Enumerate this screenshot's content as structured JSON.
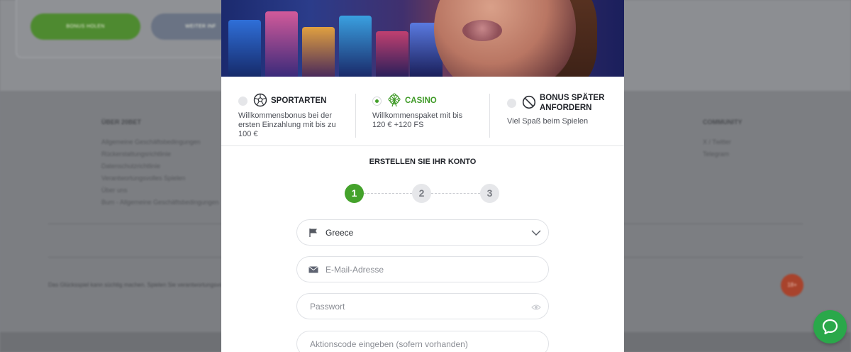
{
  "background": {
    "buttons": {
      "bonus": "BONUS HOLEN",
      "other": "WEITER INF"
    },
    "footer": {
      "col1_title": "ÜBER 20BET",
      "col1_links": [
        "Allgemeine Geschäftsbedingungen",
        "Rückerstattungsrichtlinie",
        "Datenschutzrichtlinie",
        "Verantwortungsvolles Spielen",
        "Über uns",
        "Bum - Allgemeine Geschäftsbedingungen"
      ],
      "col2_title": "COMMUNITY",
      "col2_links": [
        "X / Twitter",
        "Telegram"
      ],
      "note": "Das Glücksspiel kann süchtig machen. Spielen Sie verantwortungsvoll.",
      "age": "18+"
    }
  },
  "modal": {
    "bonuses": [
      {
        "icon": "soccer-ball-icon",
        "title": "SPORTARTEN",
        "desc": [
          "Willkommensbonus bei der",
          "ersten Einzahlung mit bis zu",
          "100 €"
        ],
        "selected": false
      },
      {
        "icon": "ferris-wheel-icon",
        "title": "CASINO",
        "desc": [
          "Willkommenspaket mit bis",
          "120 € +120 FS"
        ],
        "selected": true
      },
      {
        "icon": "no-bonus-icon",
        "title_lines": [
          "BONUS SPÄTER",
          "ANFORDERN"
        ],
        "desc": [
          "Viel Spaß beim Spielen"
        ],
        "selected": false
      }
    ],
    "form_title": "ERSTELLEN SIE IHR KONTO",
    "steps": [
      "1",
      "2",
      "3"
    ],
    "active_step": 1,
    "country": {
      "value": "Greece",
      "icon": "flag-icon"
    },
    "email": {
      "placeholder": "E-Mail-Adresse",
      "icon": "envelope-icon"
    },
    "password": {
      "placeholder": "Passwort",
      "icon": "eye-icon"
    },
    "promo": {
      "placeholder": "Aktionscode eingeben (sofern vorhanden)"
    }
  },
  "colors": {
    "accent_green": "#44a22b",
    "chat_green": "#2aa84a"
  }
}
